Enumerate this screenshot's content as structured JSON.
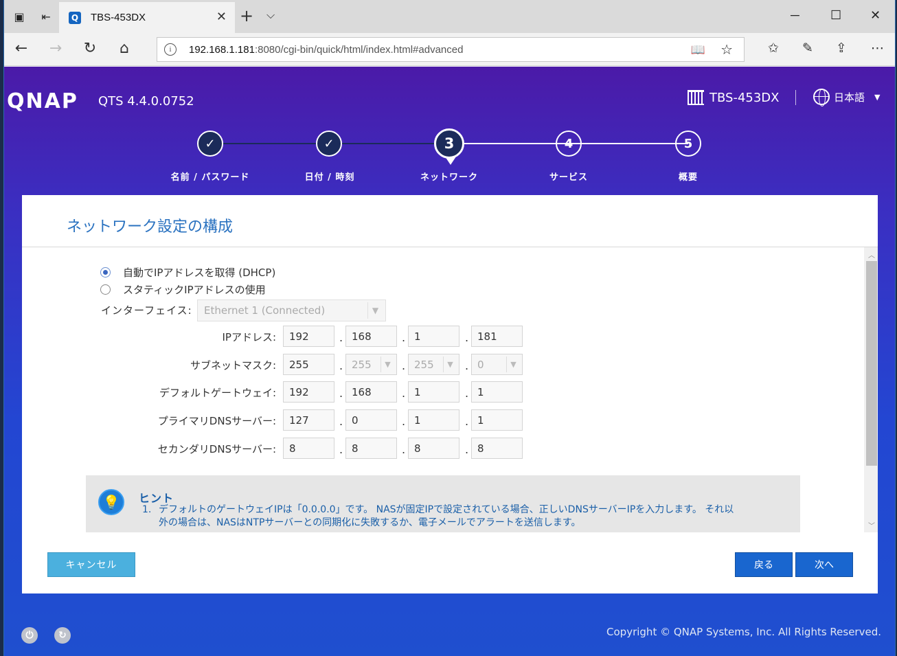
{
  "browser": {
    "tab_title": "TBS-453DX",
    "url_host": "192.168.1.181",
    "url_rest": ":8080/cgi-bin/quick/html/index.html#advanced"
  },
  "header": {
    "brand": "QNAP",
    "version": "QTS 4.4.0.0752",
    "device": "TBS-453DX",
    "language": "日本語"
  },
  "steps": [
    {
      "number": "✓",
      "label": "名前 / パスワード",
      "state": "done"
    },
    {
      "number": "✓",
      "label": "日付 / 時刻",
      "state": "done"
    },
    {
      "number": "3",
      "label": "ネットワーク",
      "state": "active"
    },
    {
      "number": "4",
      "label": "サービス",
      "state": "todo"
    },
    {
      "number": "5",
      "label": "概要",
      "state": "todo"
    }
  ],
  "panel": {
    "title": "ネットワーク設定の構成",
    "dhcp_label": "自動でIPアドレスを取得 (DHCP)",
    "static_label": "スタティックIPアドレスの使用",
    "selected_mode": "dhcp",
    "interface_label": "インターフェイス:",
    "interface_value": "Ethernet 1 (Connected)",
    "ip_label": "IPアドレス:",
    "ip": [
      "192",
      "168",
      "1",
      "181"
    ],
    "subnet_label": "サブネットマスク:",
    "subnet": [
      "255",
      "255",
      "255",
      "0"
    ],
    "gateway_label": "デフォルトゲートウェイ:",
    "gateway": [
      "192",
      "168",
      "1",
      "1"
    ],
    "dns1_label": "プライマリDNSサーバー:",
    "dns1": [
      "127",
      "0",
      "1",
      "1"
    ],
    "dns2_label": "セカンダリDNSサーバー:",
    "dns2": [
      "8",
      "8",
      "8",
      "8"
    ],
    "hint_title": "ヒント",
    "hint_1_num": "1.",
    "hint_1_line1": "デフォルトのゲートウェイIPは「0.0.0.0」です。 NASが固定IPで設定されている場合、正しいDNSサーバーIPを入力します。 それ以",
    "hint_1_line2": "外の場合は、NASはNTPサーバーとの同期化に失敗するか、電子メールでアラートを送信します。"
  },
  "buttons": {
    "cancel": "キャンセル",
    "back": "戻る",
    "next": "次へ"
  },
  "footer": {
    "copyright": "Copyright © QNAP Systems, Inc. All Rights Reserved."
  }
}
